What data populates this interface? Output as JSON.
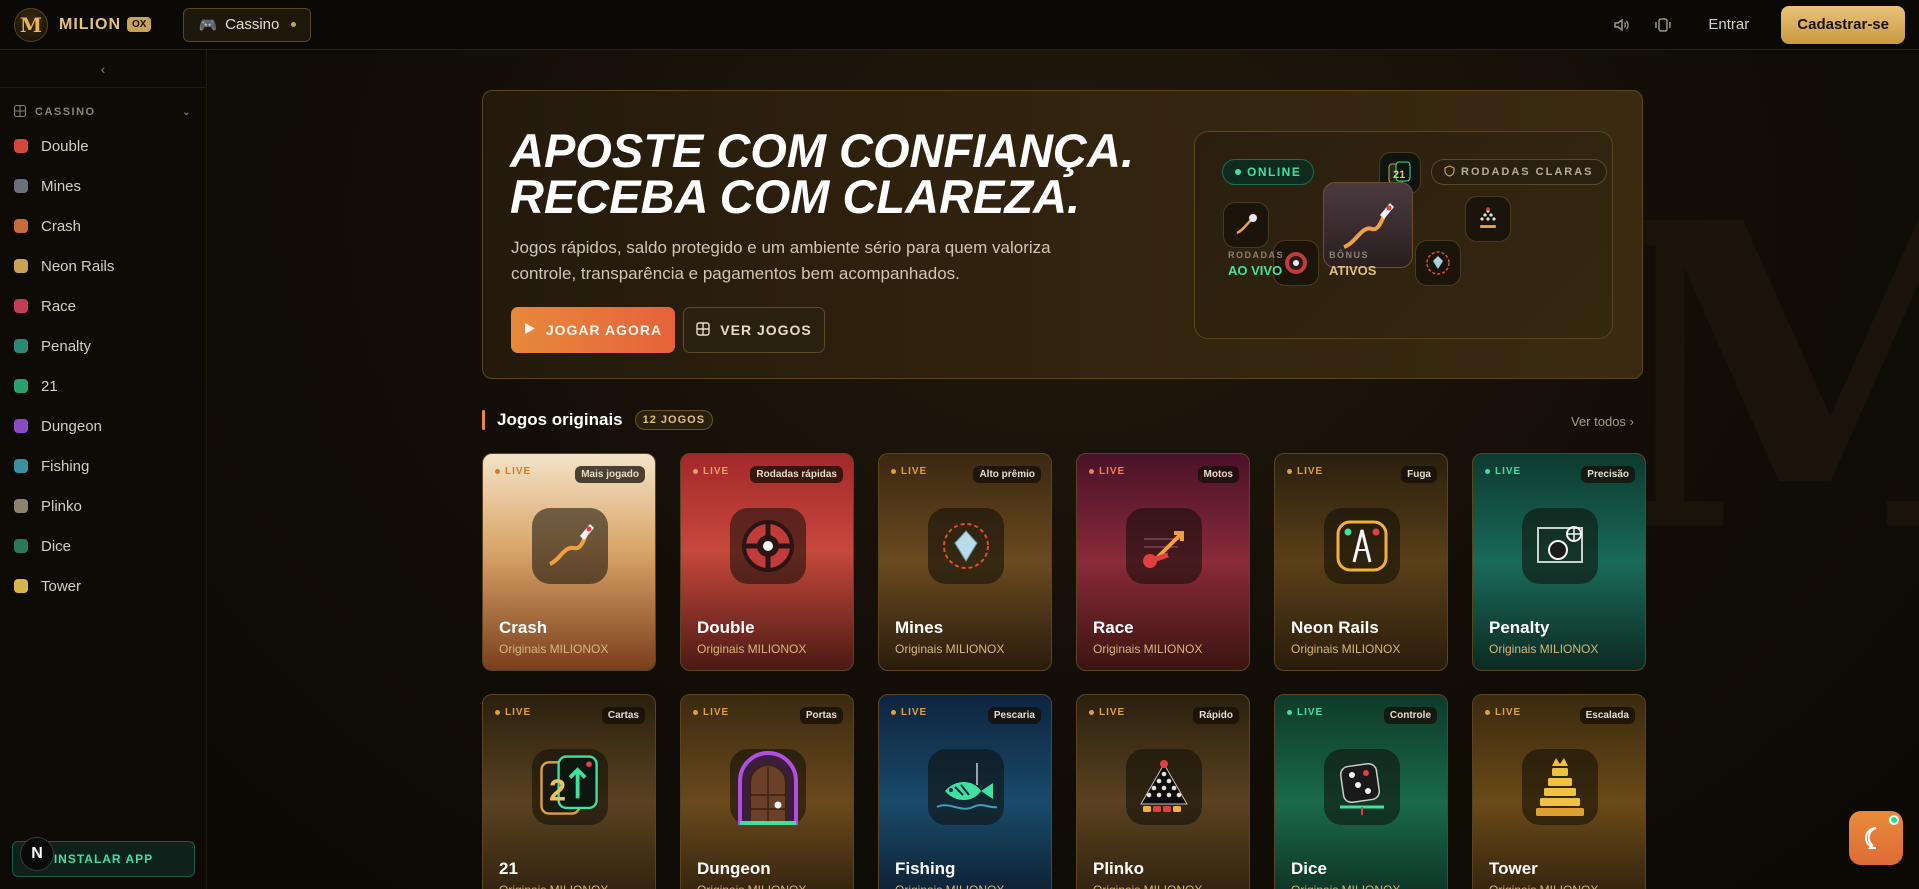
{
  "header": {
    "logo_text": "MILION",
    "logo_badge": "OX",
    "casino_label": "Cassino",
    "entrar": "Entrar",
    "cadastrar": "Cadastrar-se"
  },
  "sidebar": {
    "section": "CASSINO",
    "items": [
      {
        "label": "Double",
        "color": "#d2473a"
      },
      {
        "label": "Mines",
        "color": "#6a6f7a"
      },
      {
        "label": "Crash",
        "color": "#c86a3a"
      },
      {
        "label": "Neon Rails",
        "color": "#c9a25a"
      },
      {
        "label": "Race",
        "color": "#c23b57"
      },
      {
        "label": "Penalty",
        "color": "#2b8a73"
      },
      {
        "label": "21",
        "color": "#2aa06e"
      },
      {
        "label": "Dungeon",
        "color": "#8a4ac8"
      },
      {
        "label": "Fishing",
        "color": "#3a8fa0"
      },
      {
        "label": "Plinko",
        "color": "#8b8272"
      },
      {
        "label": "Dice",
        "color": "#2a7a5a"
      },
      {
        "label": "Tower",
        "color": "#d8b44a"
      }
    ],
    "install": "INSTALAR APP",
    "n_badge": "N"
  },
  "hero": {
    "title_line1": "APOSTE COM CONFIANÇA.",
    "title_line2": "RECEBA COM CLAREZA.",
    "subtitle": "Jogos rápidos, saldo protegido e um ambiente sério para quem valoriza controle, transparência e pagamentos bem acompanhados.",
    "btn_play": "JOGAR AGORA",
    "btn_games": "VER JOGOS",
    "card": {
      "online": "ONLINE",
      "rodadas_claras": "RODADAS CLARAS",
      "label_rodadas": "RODADAS",
      "val_rodadas": "AO VIVO",
      "label_bonus": "BÔNUS",
      "val_bonus": "ATIVOS"
    }
  },
  "section": {
    "title": "Jogos originais",
    "badge": "12 JOGOS",
    "ver_todos": "Ver todos"
  },
  "games": [
    {
      "name": "Crash",
      "sub": "Originais MILIONOX",
      "live": "LIVE",
      "tag": "Mais jogado",
      "icon": "rocket-icon",
      "bg": "linear-gradient(180deg,#f3e3c6 0%,#d9a468 45%,#7a3e1c 100%)",
      "live_color": "#d27a2a"
    },
    {
      "name": "Double",
      "sub": "Originais MILIONOX",
      "live": "LIVE",
      "tag": "Rodadas rápidas",
      "icon": "wheel-icon",
      "bg": "linear-gradient(180deg,#a3282a 0%,#c7483c 45%,#4a1a14 100%)",
      "live_color": "#f0a060"
    },
    {
      "name": "Mines",
      "sub": "Originais MILIONOX",
      "live": "LIVE",
      "tag": "Alto prêmio",
      "icon": "diamond-icon",
      "bg": "linear-gradient(180deg,#3a2810 0%,#6a4a20 50%,#2a1c0c 100%)",
      "live_color": "#e0a040"
    },
    {
      "name": "Race",
      "sub": "Originais MILIONOX",
      "live": "LIVE",
      "tag": "Motos",
      "icon": "moto-icon",
      "bg": "linear-gradient(180deg,#4a1228 0%,#8a2a3a 50%,#3a1410 100%)",
      "live_color": "#f08050"
    },
    {
      "name": "Neon Rails",
      "sub": "Originais MILIONOX",
      "live": "LIVE",
      "tag": "Fuga",
      "icon": "rails-icon",
      "bg": "linear-gradient(180deg,#2a1f0e 0%,#5a4018 50%,#2a1c0c 100%)",
      "live_color": "#e0a040"
    },
    {
      "name": "Penalty",
      "sub": "Originais MILIONOX",
      "live": "LIVE",
      "tag": "Precisão",
      "icon": "goal-icon",
      "bg": "linear-gradient(180deg,#0d3a30 0%,#1a6a58 50%,#0c2a22 100%)",
      "live_color": "#40e0a0"
    },
    {
      "name": "21",
      "sub": "Originais MILIONOX",
      "live": "LIVE",
      "tag": "Cartas",
      "icon": "cards-icon",
      "bg": "linear-gradient(180deg,#2a200e 0%,#5a4220 50%,#2a1c0c 100%)",
      "live_color": "#e0a040"
    },
    {
      "name": "Dungeon",
      "sub": "Originais MILIONOX",
      "live": "LIVE",
      "tag": "Portas",
      "icon": "door-icon",
      "bg": "linear-gradient(180deg,#3a2a10 0%,#6a4a1c 50%,#2a1c0c 100%)",
      "live_color": "#e0a040"
    },
    {
      "name": "Fishing",
      "sub": "Originais MILIONOX",
      "live": "LIVE",
      "tag": "Pescaria",
      "icon": "fish-icon",
      "bg": "linear-gradient(180deg,#0e2440 0%,#1a4a6a 50%,#0c1a2a 100%)",
      "live_color": "#e0a040"
    },
    {
      "name": "Plinko",
      "sub": "Originais MILIONOX",
      "live": "LIVE",
      "tag": "Rápido",
      "icon": "plinko-icon",
      "bg": "linear-gradient(180deg,#2a200e 0%,#5a4220 50%,#2a1c0c 100%)",
      "live_color": "#e0a040"
    },
    {
      "name": "Dice",
      "sub": "Originais MILIONOX",
      "live": "LIVE",
      "tag": "Controle",
      "icon": "dice-icon",
      "bg": "linear-gradient(180deg,#0e3a2a 0%,#1a6a4a 50%,#0c2a1e 100%)",
      "live_color": "#40e0a0"
    },
    {
      "name": "Tower",
      "sub": "Originais MILIONOX",
      "live": "LIVE",
      "tag": "Escalada",
      "icon": "tower-icon",
      "bg": "linear-gradient(180deg,#3a2a0e 0%,#6a4a18 50%,#2a1c0c 100%)",
      "live_color": "#e0a040"
    }
  ]
}
